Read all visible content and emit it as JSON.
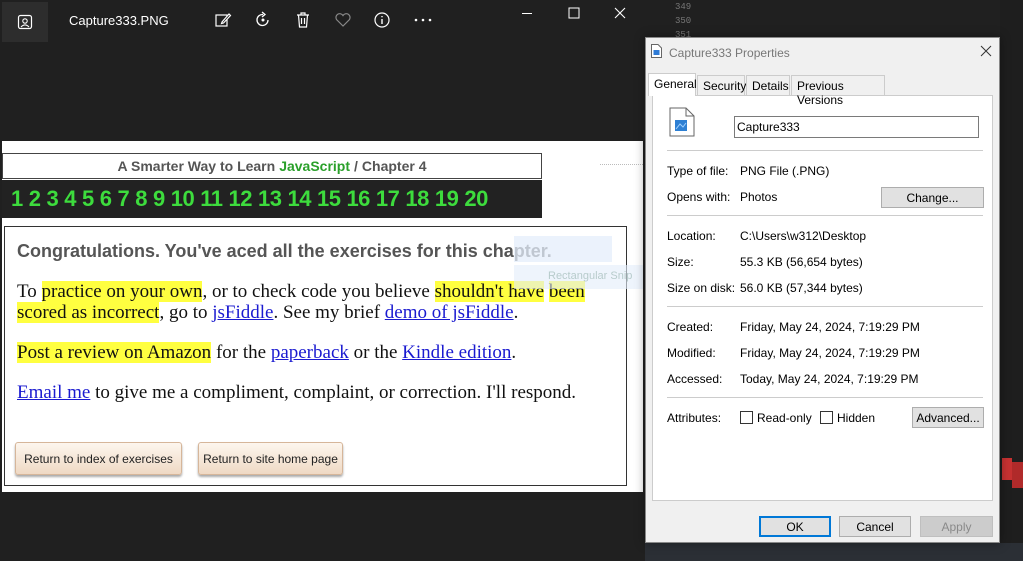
{
  "viewer": {
    "title": "Capture333.PNG",
    "toolbar": [
      "edit-image-icon",
      "rotate-icon",
      "delete-icon",
      "favorite-icon",
      "info-icon",
      "more-icon"
    ]
  },
  "image_content": {
    "header_prefix": "A Smarter Way to Learn",
    "header_js": "JavaScript",
    "header_sep": "/",
    "header_chapter": "Chapter 4",
    "numbers": [
      "1",
      "2",
      "3",
      "4",
      "5",
      "6",
      "7",
      "8",
      "9",
      "10",
      "11",
      "12",
      "13",
      "14",
      "15",
      "16",
      "17",
      "18",
      "19",
      "20"
    ],
    "congrats": "Congratulations. You've aced all the exercises for this chapter.",
    "p1": {
      "a": "To ",
      "b": "practice on your own",
      "c": ", or to check code you believe ",
      "d": "shouldn't have",
      "e": "been scored as incorrect",
      "f": ", go to ",
      "g": "jsFiddle",
      "h": ". See my brief ",
      "i": "demo of jsFiddle",
      "j": "."
    },
    "p2": {
      "a": "Post a review on Amazon",
      "b": " for the ",
      "c": "paperback",
      "d": " or the ",
      "e": "Kindle edition",
      "f": "."
    },
    "p3": {
      "a": "Email me",
      "b": " to give me a compliment, complaint, or correction. I'll respond."
    },
    "btn_index": "Return to index of exercises",
    "btn_home": "Return to site home page",
    "ghost_text": "Rectangular Snip"
  },
  "background_code": [
    "349",
    "350",
    "351"
  ],
  "dialog": {
    "title": "Capture333 Properties",
    "tabs": [
      "General",
      "Security",
      "Details",
      "Previous Versions"
    ],
    "filename": "Capture333",
    "type_label": "Type of file:",
    "type_value": "PNG File (.PNG)",
    "opens_label": "Opens with:",
    "opens_value": "Photos",
    "change_btn": "Change...",
    "location_label": "Location:",
    "location_value": "C:\\Users\\w312\\Desktop",
    "size_label": "Size:",
    "size_value": "55.3 KB (56,654 bytes)",
    "disk_label": "Size on disk:",
    "disk_value": "56.0 KB (57,344 bytes)",
    "created_label": "Created:",
    "created_value": "Friday, May 24, 2024, 7:19:29 PM",
    "modified_label": "Modified:",
    "modified_value": "Friday, May 24, 2024, 7:19:29 PM",
    "accessed_label": "Accessed:",
    "accessed_value": "Today, May 24, 2024, 7:19:29 PM",
    "attributes_label": "Attributes:",
    "readonly_label": "Read-only",
    "hidden_label": "Hidden",
    "advanced_btn": "Advanced...",
    "ok": "OK",
    "cancel": "Cancel",
    "apply": "Apply"
  }
}
